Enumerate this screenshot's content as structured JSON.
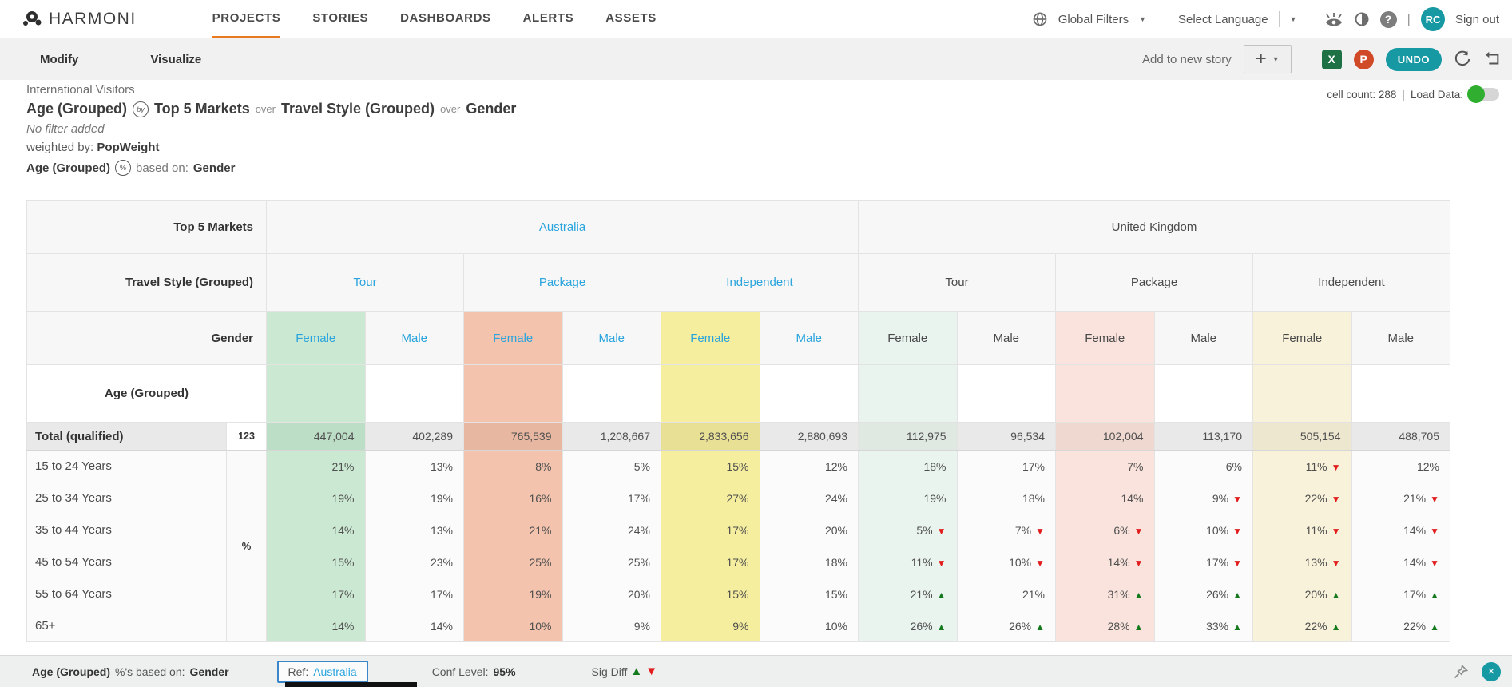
{
  "nav": {
    "brand": "HARMONI",
    "tabs": [
      {
        "label": "PROJECTS",
        "active": true
      },
      {
        "label": "STORIES",
        "active": false
      },
      {
        "label": "DASHBOARDS",
        "active": false
      },
      {
        "label": "ALERTS",
        "active": false
      },
      {
        "label": "ASSETS",
        "active": false
      }
    ],
    "global_filters_label": "Global Filters",
    "select_language_label": "Select Language",
    "help_glyph": "?",
    "avatar_initials": "RC",
    "sign_out_label": "Sign out"
  },
  "toolbar": {
    "modify_label": "Modify",
    "visualize_label": "Visualize",
    "add_to_story_label": "Add to new story",
    "excel_glyph": "X",
    "ppt_glyph": "P",
    "undo_label": "UNDO"
  },
  "report_header": {
    "dataset_name": "International Visitors",
    "measure": "Age (Grouped)",
    "by_icon": "by",
    "dim1": "Top 5 Markets",
    "over1": "over",
    "dim2": "Travel Style (Grouped)",
    "over2": "over",
    "dim3": "Gender",
    "filter_note": "No filter added",
    "weighted_by_label": "weighted by:",
    "weight_variable": "PopWeight",
    "pct_measure": "Age (Grouped)",
    "pct_icon": "%",
    "based_on_label": "based on:",
    "based_on_value": "Gender",
    "cell_count_label": "cell count: 288",
    "divider": "|",
    "load_data_label": "Load Data:"
  },
  "table": {
    "header_labels": {
      "markets": "Top 5 Markets",
      "styles": "Travel Style (Grouped)",
      "genders": "Gender",
      "ages": "Age (Grouped)"
    },
    "markets": [
      {
        "label": "Australia",
        "highlight": true
      },
      {
        "label": "United Kingdom",
        "highlight": false
      }
    ],
    "styles": [
      {
        "label": "Tour",
        "highlight": true
      },
      {
        "label": "Package",
        "highlight": true
      },
      {
        "label": "Independent",
        "highlight": true
      },
      {
        "label": "Tour",
        "highlight": false
      },
      {
        "label": "Package",
        "highlight": false
      },
      {
        "label": "Independent",
        "highlight": false
      }
    ],
    "genders": [
      {
        "label": "Female",
        "highlight": true
      },
      {
        "label": "Male",
        "highlight": true
      },
      {
        "label": "Female",
        "highlight": true
      },
      {
        "label": "Male",
        "highlight": true
      },
      {
        "label": "Female",
        "highlight": true
      },
      {
        "label": "Male",
        "highlight": true
      },
      {
        "label": "Female",
        "highlight": false
      },
      {
        "label": "Male",
        "highlight": false
      },
      {
        "label": "Female",
        "highlight": false
      },
      {
        "label": "Male",
        "highlight": false
      },
      {
        "label": "Female",
        "highlight": false
      },
      {
        "label": "Male",
        "highlight": false
      }
    ],
    "col_colors": [
      "g",
      "n",
      "s",
      "n",
      "y",
      "n",
      "lg",
      "n",
      "lp",
      "n",
      "ly",
      "n"
    ],
    "total_row": {
      "label": "Total (qualified)",
      "badge": "123",
      "values": [
        "447,004",
        "402,289",
        "765,539",
        "1,208,667",
        "2,833,656",
        "2,880,693",
        "112,975",
        "96,534",
        "102,004",
        "113,170",
        "505,154",
        "488,705"
      ]
    },
    "pct_marker": "%",
    "rows": [
      {
        "label": "15 to 24 Years",
        "cells": [
          {
            "v": "21%"
          },
          {
            "v": "13%"
          },
          {
            "v": "8%"
          },
          {
            "v": "5%"
          },
          {
            "v": "15%"
          },
          {
            "v": "12%"
          },
          {
            "v": "18%"
          },
          {
            "v": "17%"
          },
          {
            "v": "7%"
          },
          {
            "v": "6%"
          },
          {
            "v": "11%",
            "m": "d"
          },
          {
            "v": "12%"
          }
        ]
      },
      {
        "label": "25 to 34 Years",
        "cells": [
          {
            "v": "19%"
          },
          {
            "v": "19%"
          },
          {
            "v": "16%"
          },
          {
            "v": "17%"
          },
          {
            "v": "27%"
          },
          {
            "v": "24%"
          },
          {
            "v": "19%"
          },
          {
            "v": "18%"
          },
          {
            "v": "14%"
          },
          {
            "v": "9%",
            "m": "d"
          },
          {
            "v": "22%",
            "m": "d"
          },
          {
            "v": "21%",
            "m": "d"
          }
        ]
      },
      {
        "label": "35 to 44 Years",
        "cells": [
          {
            "v": "14%"
          },
          {
            "v": "13%"
          },
          {
            "v": "21%"
          },
          {
            "v": "24%"
          },
          {
            "v": "17%"
          },
          {
            "v": "20%"
          },
          {
            "v": "5%",
            "m": "d"
          },
          {
            "v": "7%",
            "m": "d"
          },
          {
            "v": "6%",
            "m": "d"
          },
          {
            "v": "10%",
            "m": "d"
          },
          {
            "v": "11%",
            "m": "d"
          },
          {
            "v": "14%",
            "m": "d"
          }
        ]
      },
      {
        "label": "45 to 54 Years",
        "cells": [
          {
            "v": "15%"
          },
          {
            "v": "23%"
          },
          {
            "v": "25%"
          },
          {
            "v": "25%"
          },
          {
            "v": "17%"
          },
          {
            "v": "18%"
          },
          {
            "v": "11%",
            "m": "d"
          },
          {
            "v": "10%",
            "m": "d"
          },
          {
            "v": "14%",
            "m": "d"
          },
          {
            "v": "17%",
            "m": "d"
          },
          {
            "v": "13%",
            "m": "d"
          },
          {
            "v": "14%",
            "m": "d"
          }
        ]
      },
      {
        "label": "55 to 64 Years",
        "cells": [
          {
            "v": "17%"
          },
          {
            "v": "17%"
          },
          {
            "v": "19%"
          },
          {
            "v": "20%"
          },
          {
            "v": "15%"
          },
          {
            "v": "15%"
          },
          {
            "v": "21%",
            "m": "u"
          },
          {
            "v": "21%"
          },
          {
            "v": "31%",
            "m": "u"
          },
          {
            "v": "26%",
            "m": "u"
          },
          {
            "v": "20%",
            "m": "u"
          },
          {
            "v": "17%",
            "m": "u"
          }
        ]
      },
      {
        "label": "65+",
        "cells": [
          {
            "v": "14%"
          },
          {
            "v": "14%"
          },
          {
            "v": "10%"
          },
          {
            "v": "9%"
          },
          {
            "v": "9%"
          },
          {
            "v": "10%"
          },
          {
            "v": "26%",
            "m": "u"
          },
          {
            "v": "26%",
            "m": "u"
          },
          {
            "v": "28%",
            "m": "u"
          },
          {
            "v": "33%",
            "m": "u"
          },
          {
            "v": "22%",
            "m": "u"
          },
          {
            "v": "22%",
            "m": "u"
          }
        ]
      }
    ]
  },
  "footer": {
    "measure": "Age (Grouped)",
    "based_text": "%'s based on:",
    "based_value": "Gender",
    "ref_label": "Ref:",
    "ref_value": "Australia",
    "conf_label": "Conf Level:",
    "conf_value": "95%",
    "sigdiff_label": "Sig Diff"
  },
  "colors": {
    "accent_orange": "#e87a22",
    "link_blue": "#29a4dd",
    "teal": "#1699a3",
    "sig_up_green": "#157a1e",
    "sig_down_red": "#e11d1d",
    "au_tour_female": "#cbe8d2",
    "au_package_female": "#f3c3ae",
    "au_independent_female": "#f5ee9e",
    "uk_tour_female": "#e9f4ee",
    "uk_package_female": "#f9e3dc",
    "uk_independent_female": "#f8f2da"
  }
}
